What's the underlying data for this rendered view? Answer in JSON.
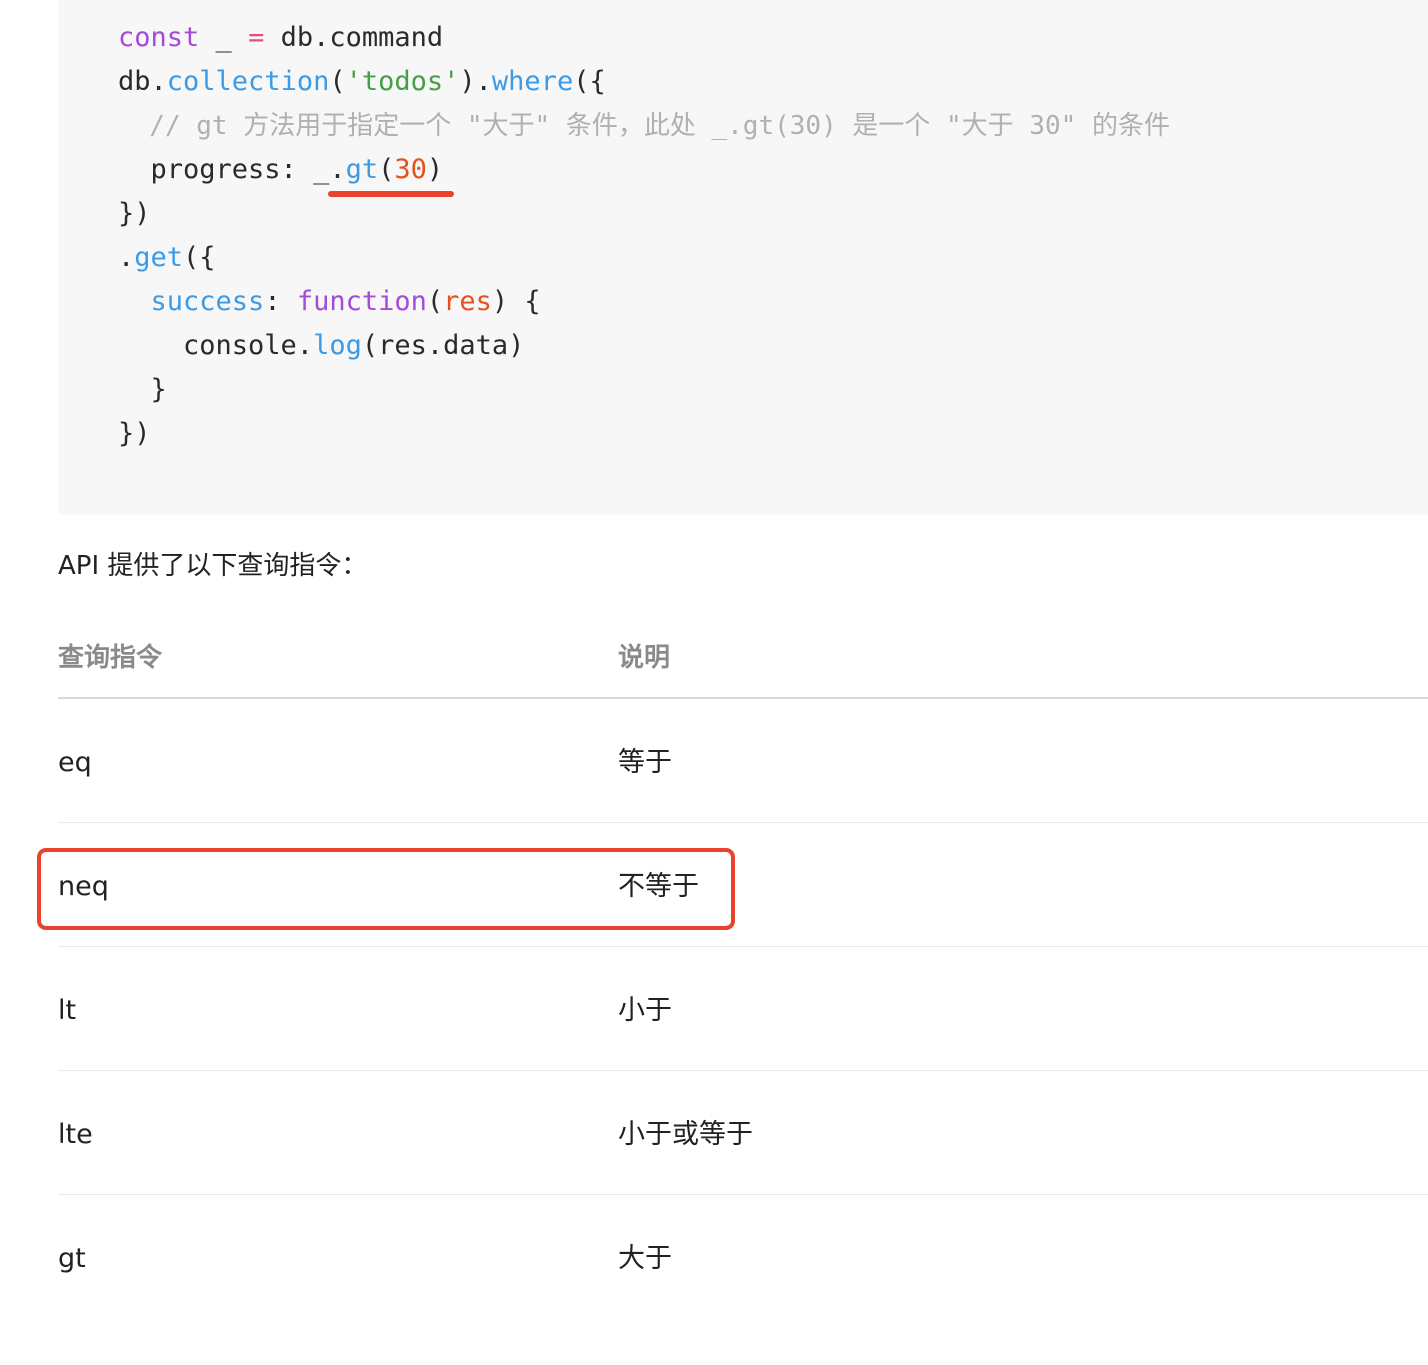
{
  "code": {
    "line1": {
      "kw": "const",
      "var": " _ ",
      "op": "=",
      "rest": " db.command"
    },
    "line2": {
      "obj": "db.",
      "fn1": "collection",
      "p1": "(",
      "str": "'todos'",
      "p2": ").",
      "fn2": "where",
      "p3": "({"
    },
    "line3": {
      "comment": "  // gt 方法用于指定一个 \"大于\" 条件，此处 _.gt(30) 是一个 \"大于 30\" 的条件"
    },
    "line4": {
      "prefix": "  progress: _.",
      "fn": "gt",
      "p1": "(",
      "num": "30",
      "p2": ")"
    },
    "line5": {
      "text": "})"
    },
    "line6": {
      "dot": ".",
      "fn": "get",
      "p": "({"
    },
    "line7": {
      "indent": "  ",
      "key": "success",
      "colon": ": ",
      "kw": "function",
      "p1": "(",
      "param": "res",
      "p2": ") {"
    },
    "line8": {
      "prefix": "    console.",
      "fn": "log",
      "rest": "(res.data)"
    },
    "line9": {
      "text": "  }"
    },
    "line10": {
      "text": "})"
    }
  },
  "intro_text": "API 提供了以下查询指令：",
  "table": {
    "headers": {
      "command": "查询指令",
      "description": "说明"
    },
    "rows": [
      {
        "command": "eq",
        "description": "等于"
      },
      {
        "command": "neq",
        "description": "不等于"
      },
      {
        "command": "lt",
        "description": "小于"
      },
      {
        "command": "lte",
        "description": "小于或等于"
      },
      {
        "command": "gt",
        "description": "大于"
      }
    ]
  },
  "colors": {
    "keyword": "#a54bd9",
    "function": "#3c9be6",
    "string": "#44a046",
    "number": "#e2531f",
    "annotation_red": "#e8432c"
  }
}
